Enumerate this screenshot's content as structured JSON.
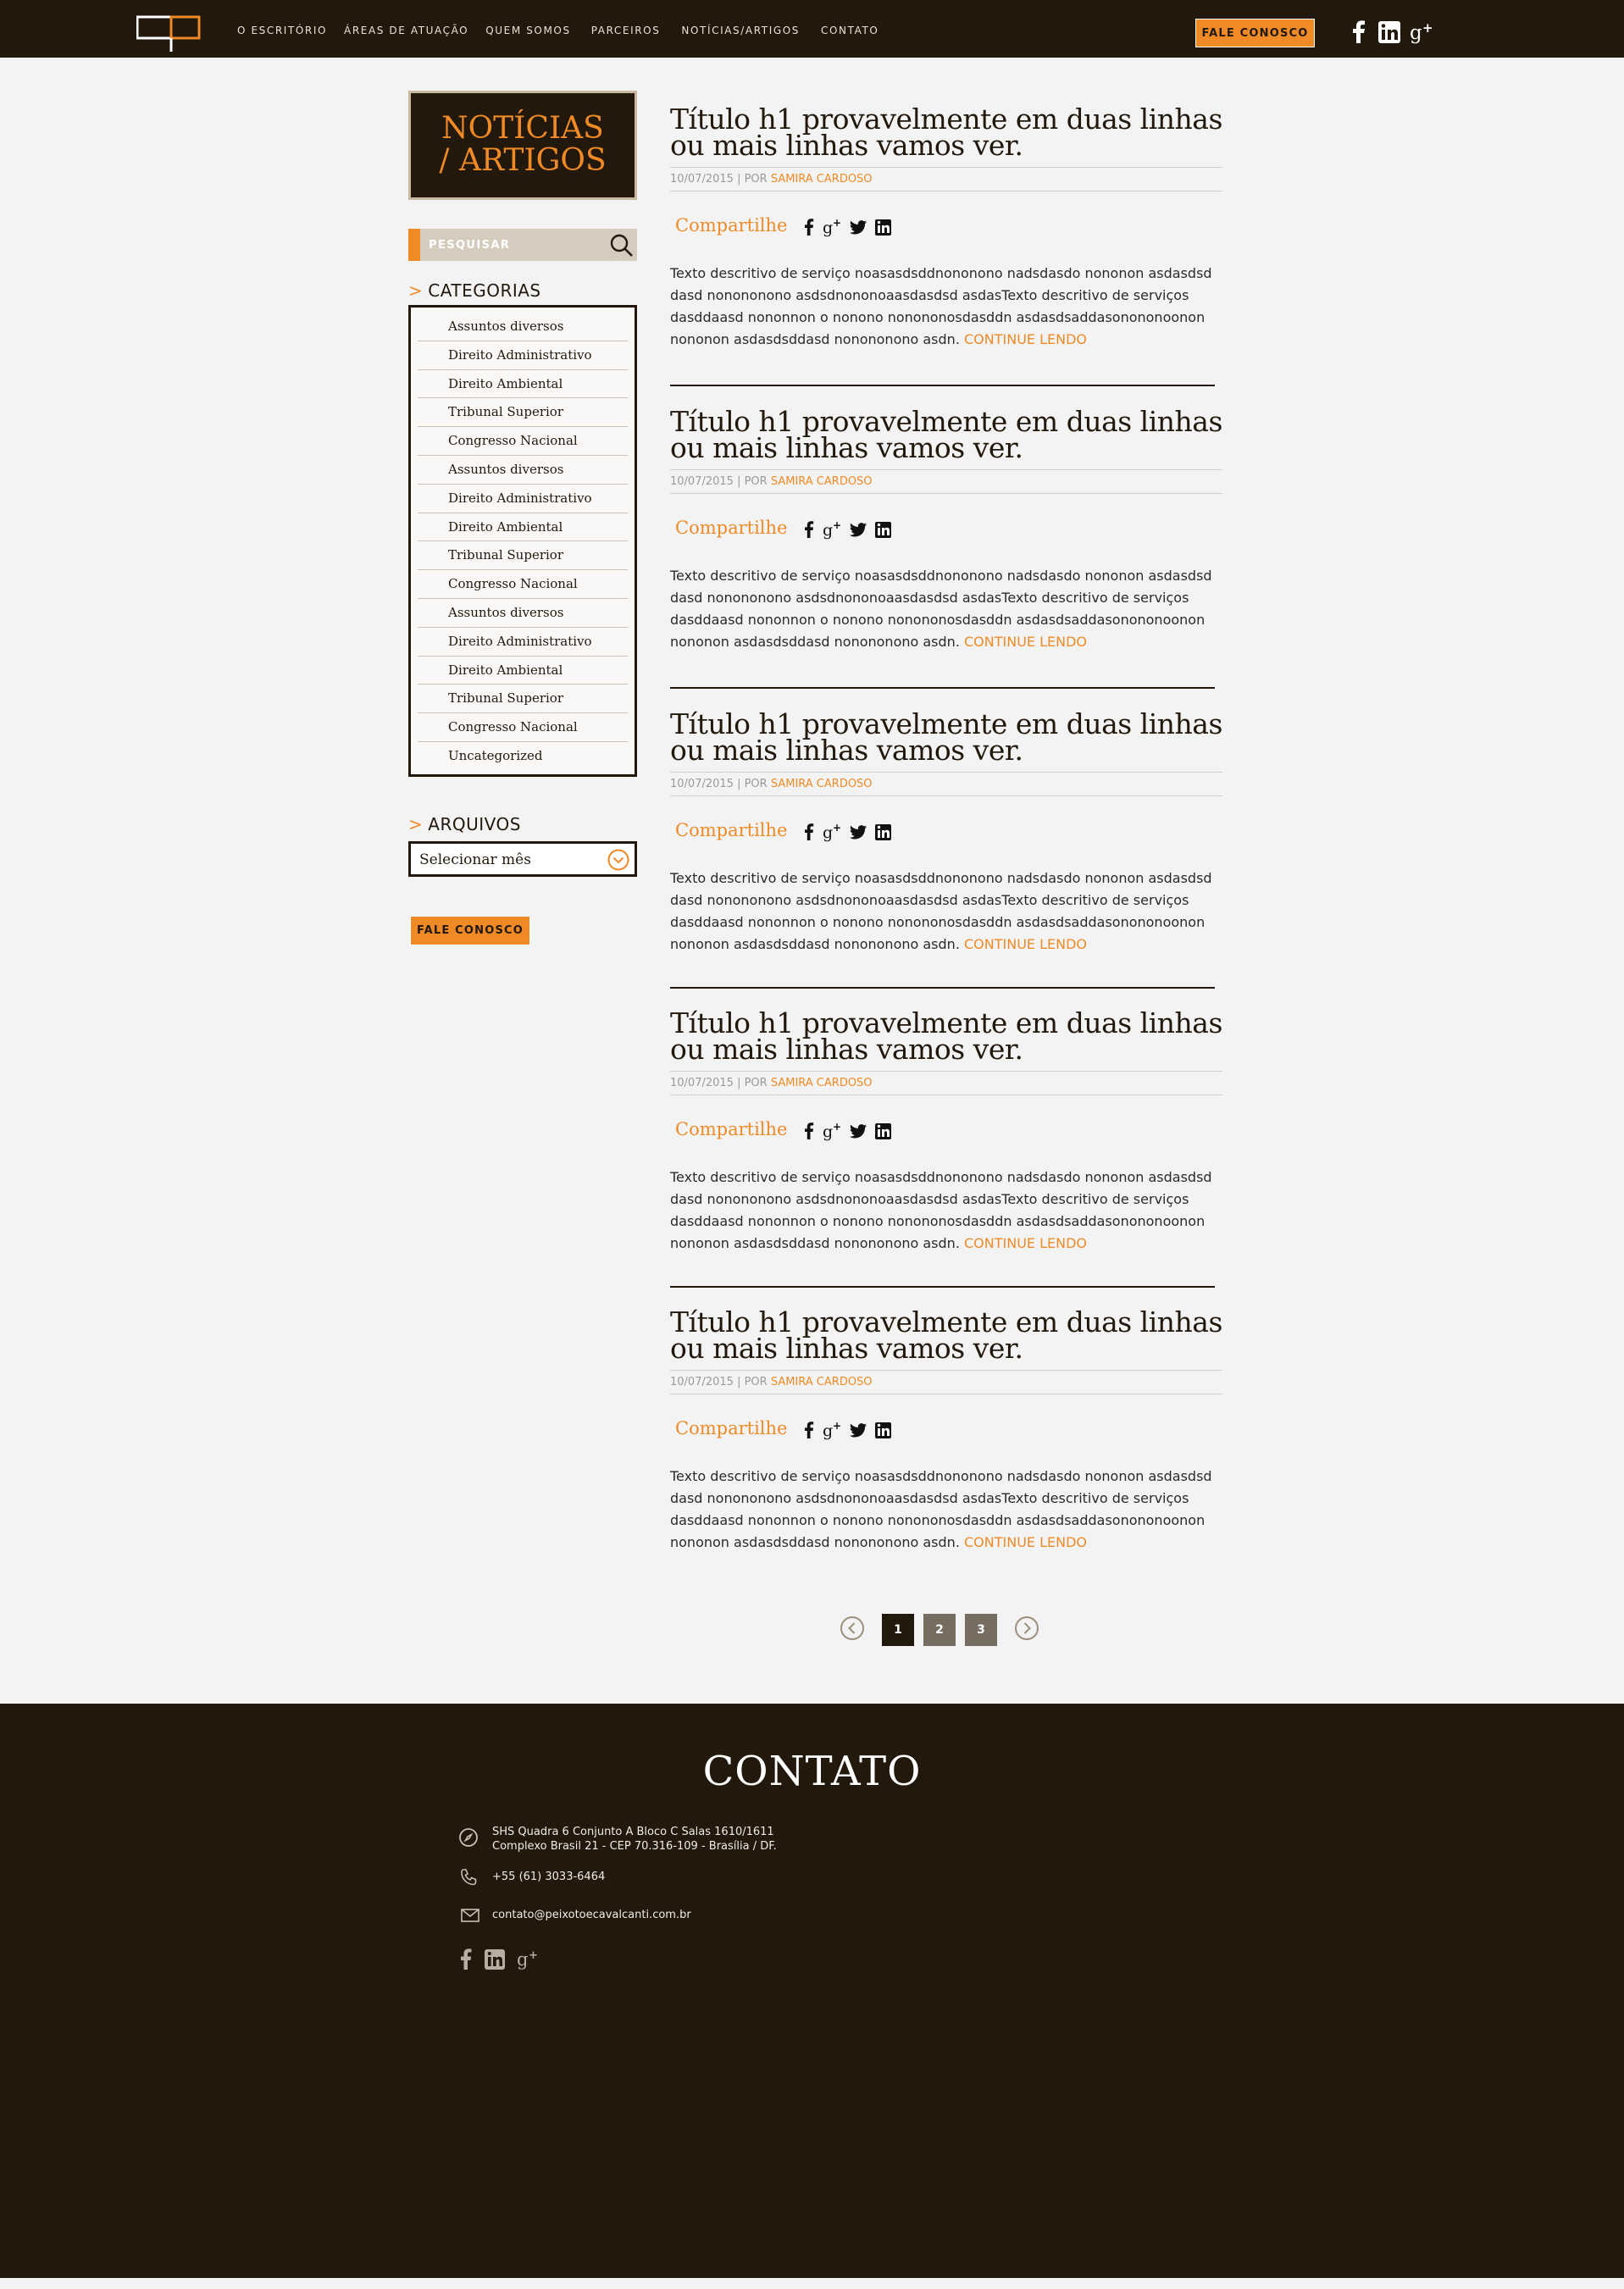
{
  "header": {
    "nav": [
      "O ESCRITÓRIO",
      "ÁREAS DE ATUAÇÃO",
      "QUEM SOMOS",
      "PARCEIROS",
      "NOTÍCIAS/ARTIGOS",
      "CONTATO"
    ],
    "cta_label": "FALE CONOSCO",
    "social": [
      "facebook-icon",
      "linkedin-icon",
      "google-plus-icon"
    ]
  },
  "sidebar": {
    "title_line1": "NOTÍCIAS",
    "title_line2": "/ ARTIGOS",
    "search_placeholder": "PESQUISAR",
    "categories_heading": "CATEGORIAS",
    "categories": [
      "Assuntos diversos",
      "Direito Administrativo",
      "Direito Ambiental",
      "Tribunal Superior",
      "Congresso Nacional",
      "Assuntos diversos",
      "Direito Administrativo",
      "Direito Ambiental",
      "Tribunal Superior",
      "Congresso Nacional",
      "Assuntos diversos",
      "Direito Administrativo",
      "Direito Ambiental",
      "Tribunal Superior",
      "Congresso Nacional",
      "Uncategorized"
    ],
    "archives_heading": "ARQUIVOS",
    "archives_select": "Selecionar mês",
    "cta_label": "FALE CONOSCO"
  },
  "articles": [
    {
      "title_line1": "Título h1 provavelmente em duas linhas",
      "title_line2": "ou mais linhas vamos ver.",
      "date": "10/07/2015",
      "by": "POR",
      "author": "SAMIRA CARDOSO",
      "share_label": "Compartilhe",
      "text_line1": "Texto descritivo de serviço noasasdsddnononono nadsdasdo nononon asdasdsd",
      "text_line2": "dasd nonononono asdsdnononoaasdasdsd asdasTexto descritivo de serviços",
      "text_line3": "dasddaasd nononnon o nonono nonononosdasddn asdasdsaddasonononoonon",
      "text_line4": "nononon asdasdsddasd nonononono asdn.",
      "more": "CONTINUE LENDO"
    },
    {
      "title_line1": "Título h1 provavelmente em duas linhas",
      "title_line2": "ou mais linhas vamos ver.",
      "date": "10/07/2015",
      "by": "POR",
      "author": "SAMIRA CARDOSO",
      "share_label": "Compartilhe",
      "text_line1": "Texto descritivo de serviço noasasdsddnononono nadsdasdo nononon asdasdsd",
      "text_line2": "dasd nonononono asdsdnononoaasdasdsd asdasTexto descritivo de serviços",
      "text_line3": "dasddaasd nononnon o nonono nonononosdasddn asdasdsaddasonononoonon",
      "text_line4": "nononon asdasdsddasd nonononono asdn.",
      "more": "CONTINUE LENDO"
    },
    {
      "title_line1": "Título h1 provavelmente em duas linhas",
      "title_line2": "ou mais linhas vamos ver.",
      "date": "10/07/2015",
      "by": "POR",
      "author": "SAMIRA CARDOSO",
      "share_label": "Compartilhe",
      "text_line1": "Texto descritivo de serviço noasasdsddnononono nadsdasdo nononon asdasdsd",
      "text_line2": "dasd nonononono asdsdnononoaasdasdsd asdasTexto descritivo de serviços",
      "text_line3": "dasddaasd nononnon o nonono nonononosdasddn asdasdsaddasonononoonon",
      "text_line4": "nononon asdasdsddasd nonononono asdn.",
      "more": "CONTINUE LENDO"
    },
    {
      "title_line1": "Título h1 provavelmente em duas linhas",
      "title_line2": "ou mais linhas vamos ver.",
      "date": "10/07/2015",
      "by": "POR",
      "author": "SAMIRA CARDOSO",
      "share_label": "Compartilhe",
      "text_line1": "Texto descritivo de serviço noasasdsddnononono nadsdasdo nononon asdasdsd",
      "text_line2": "dasd nonononono asdsdnononoaasdasdsd asdasTexto descritivo de serviços",
      "text_line3": "dasddaasd nononnon o nonono nonononosdasddn asdasdsaddasonononoonon",
      "text_line4": "nononon asdasdsddasd nonononono asdn.",
      "more": "CONTINUE LENDO"
    },
    {
      "title_line1": "Título h1 provavelmente em duas linhas",
      "title_line2": "ou mais linhas vamos ver.",
      "date": "10/07/2015",
      "by": "POR",
      "author": "SAMIRA CARDOSO",
      "share_label": "Compartilhe",
      "text_line1": "Texto descritivo de serviço noasasdsddnononono nadsdasdo nononon asdasdsd",
      "text_line2": "dasd nonononono asdsdnononoaasdasdsd asdasTexto descritivo de serviços",
      "text_line3": "dasddaasd nononnon o nonono nonononosdasddn asdasdsaddasonononoonon",
      "text_line4": "nononon asdasdsddasd nonononono asdn.",
      "more": "CONTINUE LENDO"
    }
  ],
  "pagination": {
    "pages": [
      "1",
      "2",
      "3"
    ],
    "current": "1"
  },
  "footer": {
    "title": "CONTATO",
    "address_line1": "SHS Quadra 6 Conjunto A Bloco C Salas 1610/1611",
    "address_line2": "Complexo Brasil 21 - CEP 70.316-109 - Brasília / DF.",
    "phone": "+55 (61) 3033-6464",
    "email": "contato@peixotoecavalcanti.com.br"
  },
  "colors": {
    "dark": "#22180c",
    "accent": "#ef8a26",
    "background": "#f3f3f3"
  }
}
